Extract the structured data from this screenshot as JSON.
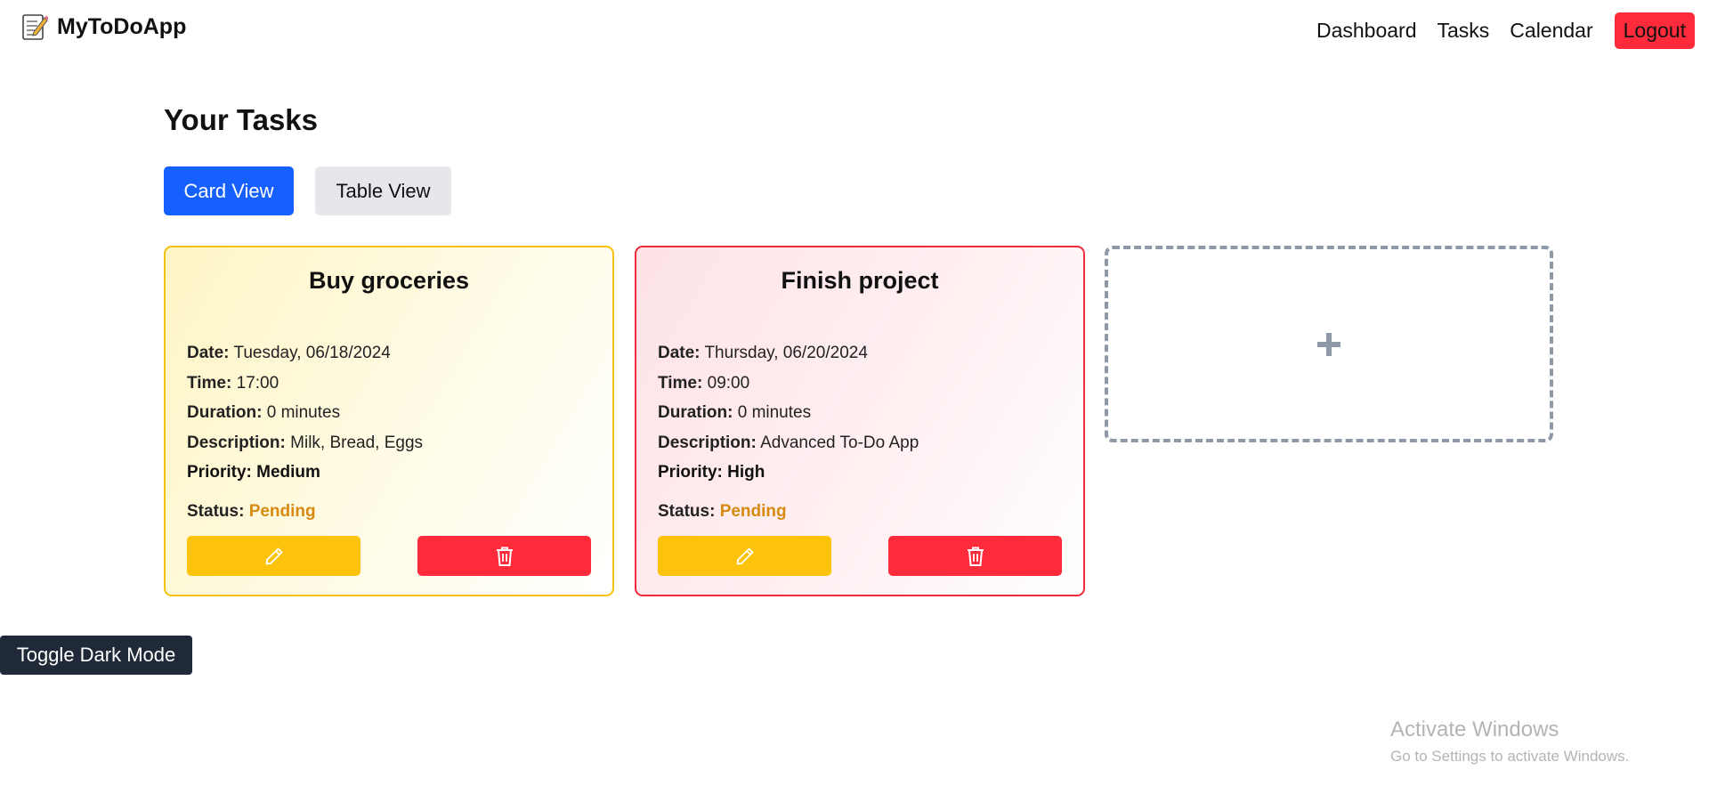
{
  "brand": {
    "name": "MyToDoApp",
    "icon": "memo-icon"
  },
  "nav": {
    "links": [
      "Dashboard",
      "Tasks",
      "Calendar"
    ],
    "logout_label": "Logout"
  },
  "page": {
    "title": "Your Tasks",
    "views": {
      "card": "Card View",
      "table": "Table View",
      "active": "card"
    }
  },
  "labels": {
    "date": "Date:",
    "time": "Time:",
    "duration": "Duration:",
    "description": "Description:",
    "priority": "Priority:",
    "status": "Status:"
  },
  "tasks": [
    {
      "title": "Buy groceries",
      "date": "Tuesday, 06/18/2024",
      "time": "17:00",
      "duration": "0 minutes",
      "description": "Milk, Bread, Eggs",
      "priority": "Medium",
      "status": "Pending",
      "border_color": "#f4c20d"
    },
    {
      "title": "Finish project",
      "date": "Thursday, 06/20/2024",
      "time": "09:00",
      "duration": "0 minutes",
      "description": "Advanced To-Do App",
      "priority": "High",
      "status": "Pending",
      "border_color": "#ef2b3c"
    }
  ],
  "icons": {
    "edit": "pencil-icon",
    "delete": "trash-icon",
    "add": "plus-icon"
  },
  "dark_mode_label": "Toggle Dark Mode",
  "watermark": {
    "title": "Activate Windows",
    "subtitle": "Go to Settings to activate Windows."
  },
  "colors": {
    "primary": "#1560ff",
    "danger": "#ff2b3a",
    "warning": "#fcc30a",
    "pending": "#d68a10",
    "dark": "#1f2937"
  }
}
